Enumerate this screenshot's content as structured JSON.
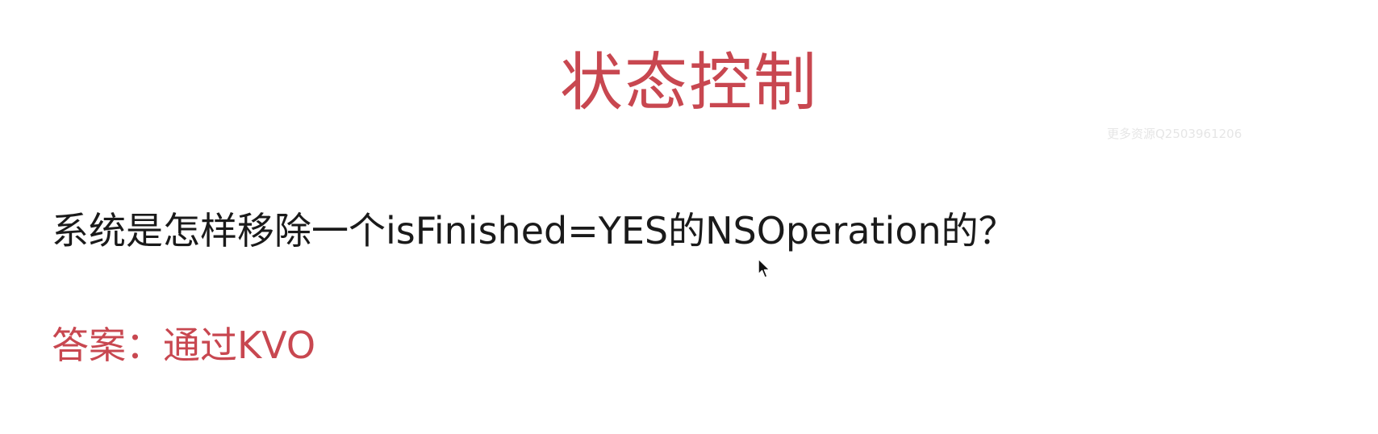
{
  "slide": {
    "title": "状态控制",
    "watermark": "更多资源Q2503961206",
    "question": "系统是怎样移除一个isFinished=YES的NSOperation的？",
    "answer": "答案：通过KVO"
  },
  "colors": {
    "accent": "#c84750",
    "text": "#1a1a1a",
    "background": "#ffffff"
  },
  "icons": {
    "cursor": "mouse-pointer-icon"
  }
}
